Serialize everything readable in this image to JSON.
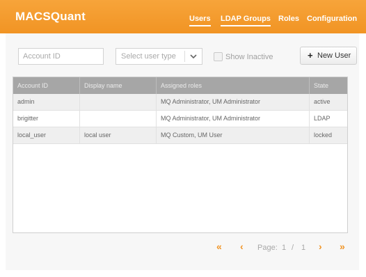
{
  "app": {
    "title": "MACSQuant"
  },
  "nav": [
    {
      "label": "Users",
      "active": true
    },
    {
      "label": "LDAP Groups",
      "active": true
    },
    {
      "label": "Roles",
      "active": false
    },
    {
      "label": "Configuration",
      "active": false
    }
  ],
  "filters": {
    "account_placeholder": "Account ID",
    "user_type_placeholder": "Select user type",
    "show_inactive_label": "Show Inactive",
    "new_user_label": "New User"
  },
  "table": {
    "columns": [
      "Account ID",
      "Display name",
      "Assigned roles",
      "State"
    ],
    "rows": [
      {
        "account": "admin",
        "display": "",
        "roles": "MQ Administrator, UM Administrator",
        "state": "active"
      },
      {
        "account": "brigitter",
        "display": "",
        "roles": "MQ Administrator, UM Administrator",
        "state": "LDAP"
      },
      {
        "account": "local_user",
        "display": "local user",
        "roles": "MQ Custom, UM User",
        "state": "locked"
      }
    ]
  },
  "pagination": {
    "label": "Page:",
    "current": "1",
    "separator": "/",
    "total": "1"
  },
  "colors": {
    "accent": "#f19424",
    "header_bg": "#a6a6a6"
  }
}
